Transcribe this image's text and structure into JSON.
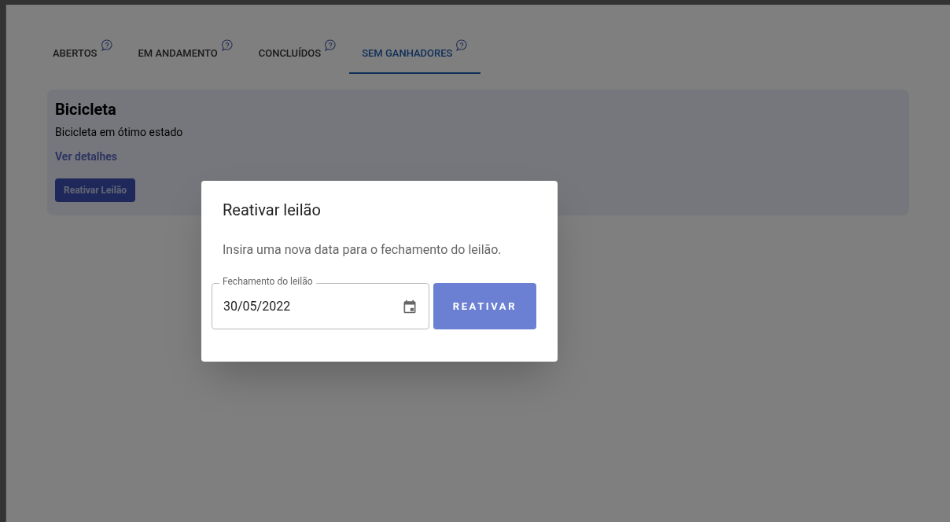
{
  "tabs": [
    {
      "label": "ABERTOS",
      "selected": false
    },
    {
      "label": "EM ANDAMENTO",
      "selected": false
    },
    {
      "label": "CONCLUÍDOS",
      "selected": false
    },
    {
      "label": "SEM GANHADORES",
      "selected": true
    }
  ],
  "auction_card": {
    "title": "Bicicleta",
    "description": "Bicicleta em ótimo estado",
    "details_link": "Ver detalhes",
    "action_button": "Reativar Leilão"
  },
  "dialog": {
    "title": "Reativar leilão",
    "message": "Insira uma nova data para o fechamento do leilão.",
    "date_field": {
      "label": "Fechamento do leilão",
      "value": "30/05/2022"
    },
    "confirm_button": "REATIVAR"
  }
}
